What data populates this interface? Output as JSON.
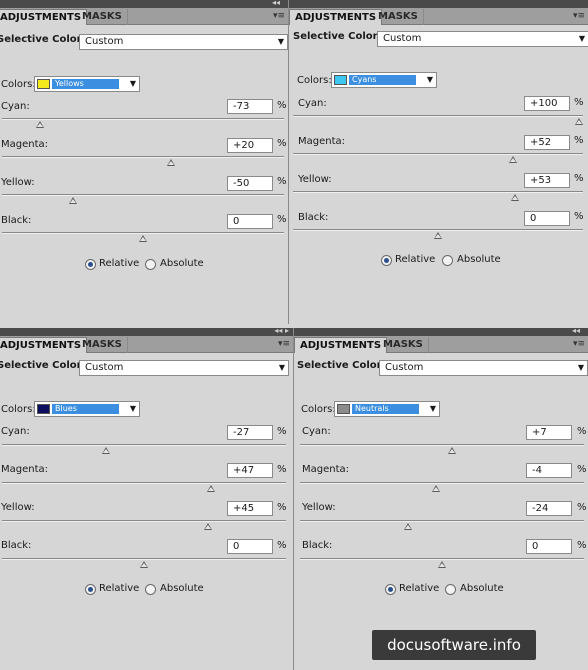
{
  "tabs": {
    "adjustments": "ADJUSTMENTS",
    "masks": "MASKS"
  },
  "labels": {
    "title": "Selective Color",
    "colors": "Colors:",
    "cyan": "Cyan:",
    "magenta": "Magenta:",
    "yellow": "Yellow:",
    "black": "Black:",
    "pct": "%",
    "relative": "Relative",
    "absolute": "Absolute"
  },
  "icons": {
    "collapse": "double-arrow-icon",
    "menu": "panel-menu-icon",
    "dropdown": "chevron-down-icon"
  },
  "panels": [
    {
      "preset": "Custom",
      "color_name": "Yellows",
      "swatch": "#f5ea1c",
      "cyan": "-73",
      "magenta": "+20",
      "yellow": "-50",
      "black": "0",
      "levels": {
        "cyan": -73,
        "magenta": 20,
        "yellow": -50,
        "black": 0
      },
      "method": "Relative"
    },
    {
      "preset": "Custom",
      "color_name": "Cyans",
      "swatch": "#3cc6f0",
      "cyan": "+100",
      "magenta": "+52",
      "yellow": "+53",
      "black": "0",
      "levels": {
        "cyan": 100,
        "magenta": 52,
        "yellow": 53,
        "black": 0
      },
      "method": "Relative"
    },
    {
      "preset": "Custom",
      "color_name": "Blues",
      "swatch": "#0c0e5e",
      "cyan": "-27",
      "magenta": "+47",
      "yellow": "+45",
      "black": "0",
      "levels": {
        "cyan": -27,
        "magenta": 47,
        "yellow": 45,
        "black": 0
      },
      "method": "Relative"
    },
    {
      "preset": "Custom",
      "color_name": "Neutrals",
      "swatch": "#8c8c8c",
      "cyan": "+7",
      "magenta": "-4",
      "yellow": "-24",
      "black": "0",
      "levels": {
        "cyan": 7,
        "magenta": -4,
        "yellow": -24,
        "black": 0
      },
      "method": "Relative"
    }
  ],
  "watermark": "docusoftware.info"
}
